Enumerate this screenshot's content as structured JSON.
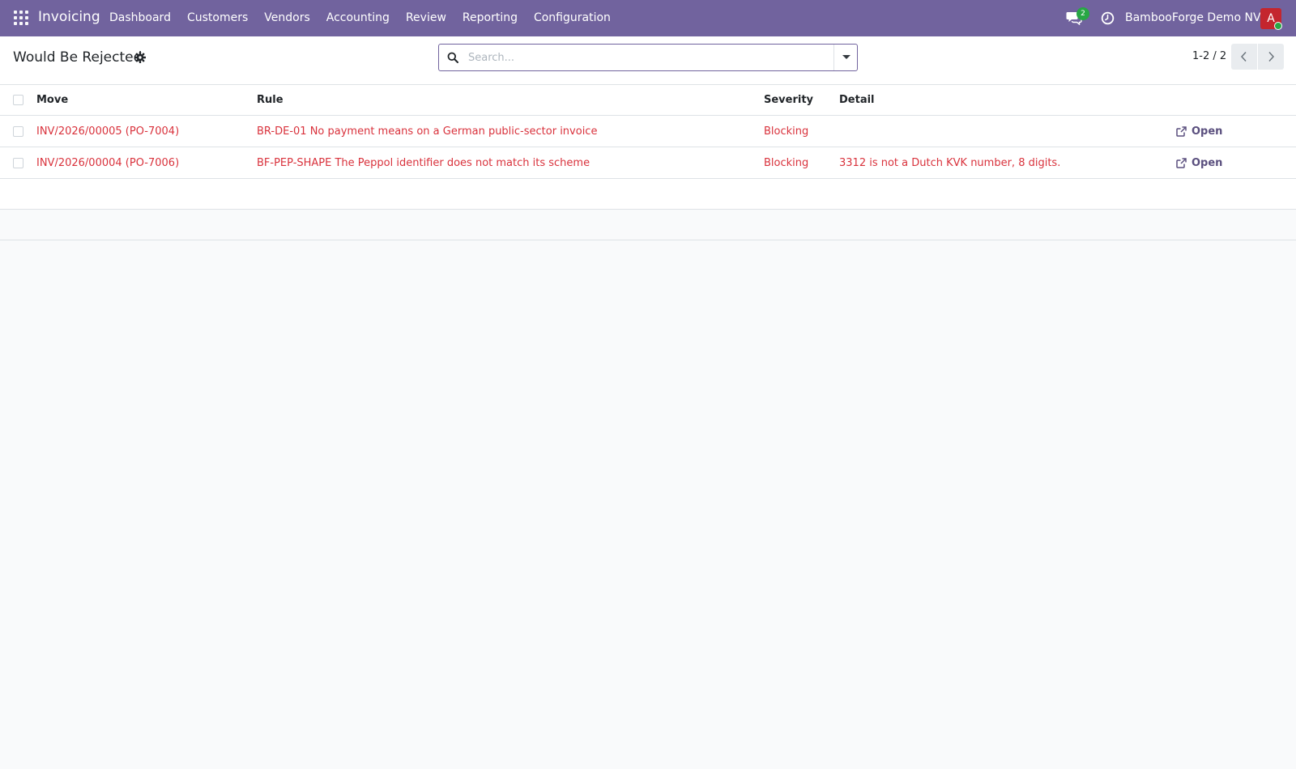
{
  "app": {
    "name": "Invoicing",
    "menu": [
      "Dashboard",
      "Customers",
      "Vendors",
      "Accounting",
      "Review",
      "Reporting",
      "Configuration"
    ],
    "chat_count": "2",
    "company": "BambooForge Demo NV",
    "avatar_letter": "A",
    "colors": {
      "navbar": "#71639e",
      "link_red": "#d9323c",
      "avatar": "#c4262e",
      "badge": "#28a745"
    }
  },
  "control_panel": {
    "title": "Would Be Rejected",
    "search_placeholder": "Search...",
    "pager": "1-2 / 2"
  },
  "table": {
    "headers": {
      "move": "Move",
      "rule": "Rule",
      "severity": "Severity",
      "detail": "Detail"
    },
    "rows": [
      {
        "move": "INV/2026/00005 (PO-7004)",
        "rule": "BR-DE-01 No payment means on a German public-sector invoice",
        "severity": "Blocking",
        "detail": "",
        "action": "Open"
      },
      {
        "move": "INV/2026/00004 (PO-7006)",
        "rule": "BF-PEP-SHAPE The Peppol identifier does not match its scheme",
        "severity": "Blocking",
        "detail": "3312 is not a Dutch KVK number, 8 digits.",
        "action": "Open"
      }
    ]
  }
}
